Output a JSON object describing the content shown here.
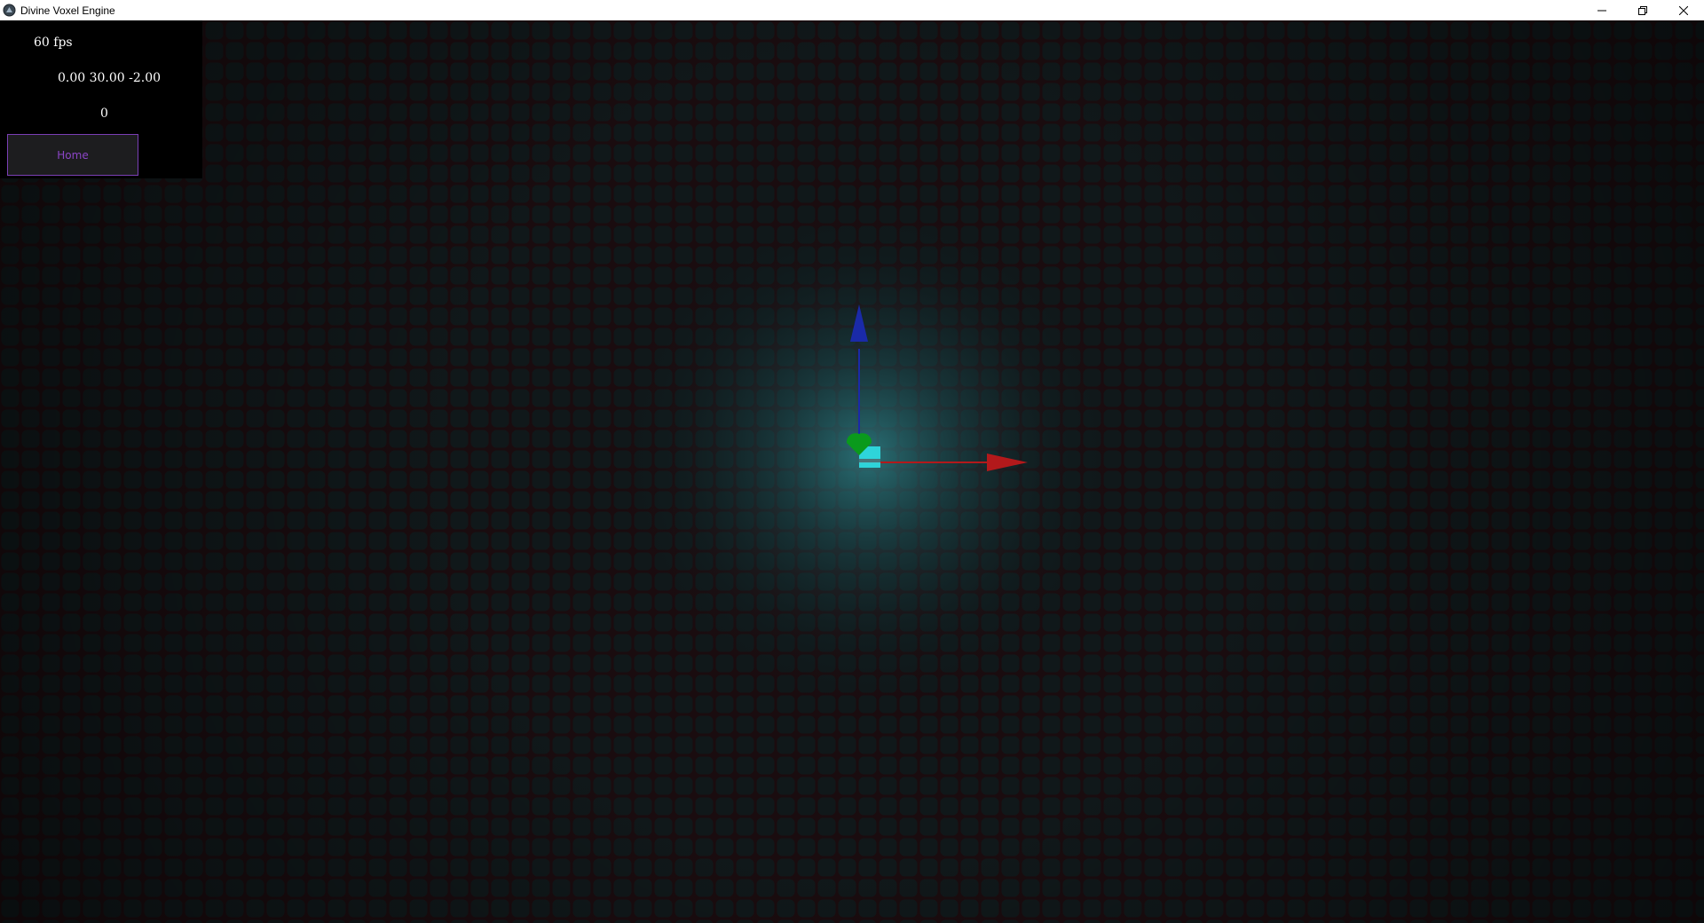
{
  "window": {
    "title": "Divine Voxel Engine",
    "controls": [
      "minimize",
      "restore",
      "close"
    ]
  },
  "hud": {
    "fps": "60 fps",
    "position": "0.00 30.00 -2.00",
    "counter": "0",
    "home_button": "Home"
  },
  "colors": {
    "accent": "#7a3fb5",
    "axis_x": "#b3191b",
    "axis_y": "#0a9a1c",
    "axis_z": "#1a2aa8",
    "voxel_glow": "#3fb7c0",
    "selected_voxel": "#2fe0e6"
  },
  "icons": [
    "app-logo-icon",
    "minimize-icon",
    "restore-icon",
    "close-icon"
  ]
}
